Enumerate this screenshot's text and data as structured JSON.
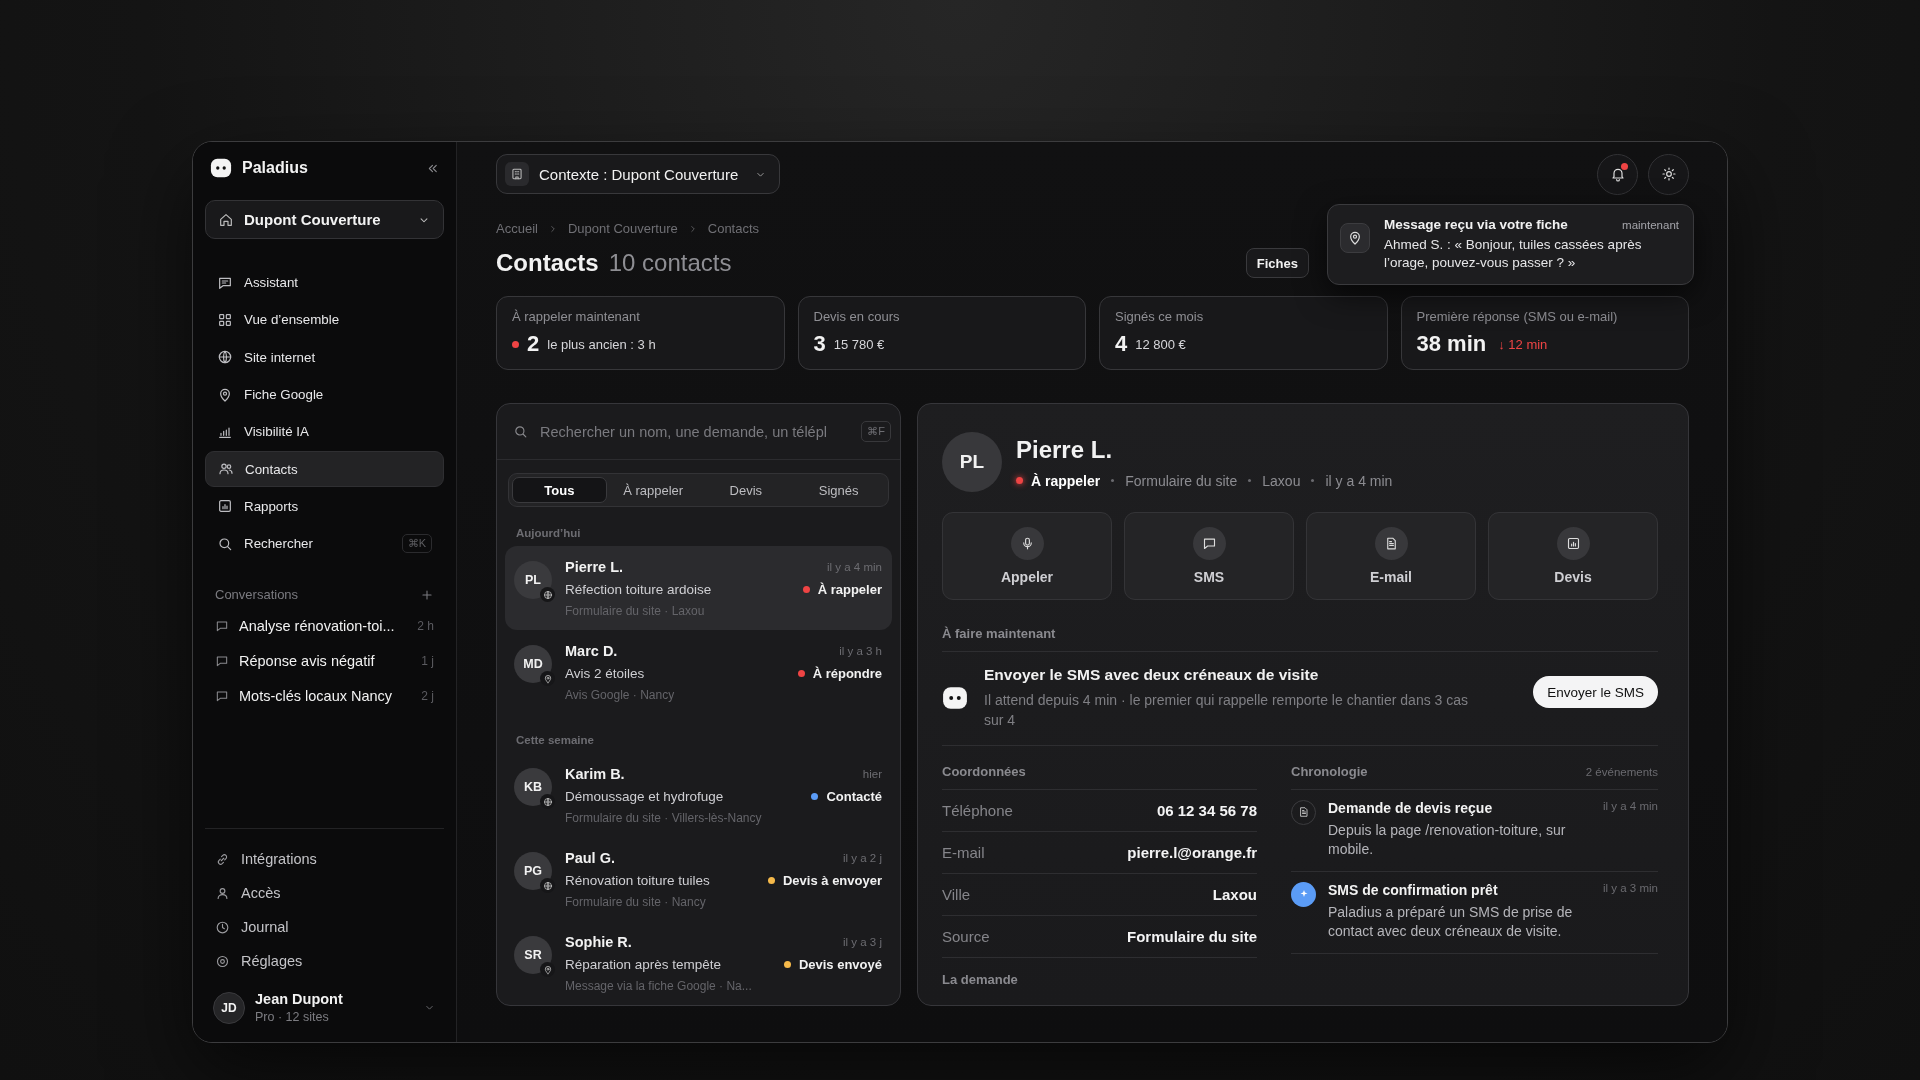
{
  "sidebar": {
    "brand": "Paladius",
    "workspace": "Dupont Couverture",
    "nav": [
      {
        "label": "Assistant",
        "selected": false
      },
      {
        "label": "Vue d’ensemble",
        "selected": false
      },
      {
        "label": "Site internet",
        "selected": false
      },
      {
        "label": "Fiche Google",
        "selected": false
      },
      {
        "label": "Visibilité IA",
        "selected": false
      },
      {
        "label": "Contacts",
        "selected": true
      },
      {
        "label": "Rapports",
        "selected": false
      },
      {
        "label": "Rechercher",
        "selected": false,
        "shortcut": "⌘K"
      }
    ],
    "conversations_title": "Conversations",
    "conversations": [
      {
        "title": "Analyse rénovation-toi...",
        "age": "2 h"
      },
      {
        "title": "Réponse avis négatif",
        "age": "1 j"
      },
      {
        "title": "Mots-clés locaux Nancy",
        "age": "2 j"
      }
    ],
    "footer_nav": [
      "Intégrations",
      "Accès",
      "Journal",
      "Réglages"
    ],
    "user": {
      "initials": "JD",
      "name": "Jean Dupont",
      "plan": "Pro · 12 sites"
    }
  },
  "header": {
    "context": "Contexte : Dupont Couverture",
    "unread": true
  },
  "toast": {
    "title": "Message reçu via votre fiche",
    "time": "maintenant",
    "body": "Ahmed S. : « Bonjour, tuiles cassées après l’orage, pouvez-vous passer ? »"
  },
  "breadcrumb": [
    "Accueil",
    "Dupont Couverture",
    "Contacts"
  ],
  "page": {
    "title": "Contacts",
    "count": "10 contacts",
    "action": "Fiches"
  },
  "stats": [
    {
      "label": "À rappeler maintenant",
      "value": "2",
      "detail": "le plus ancien : 3 h",
      "alert": true
    },
    {
      "label": "Devis en cours",
      "value": "3",
      "detail": "15 780 €",
      "alert": false
    },
    {
      "label": "Signés ce mois",
      "value": "4",
      "detail": "12 800 €",
      "alert": false
    },
    {
      "label": "Première réponse (SMS ou e-mail)",
      "value": "38 min",
      "trend": "↓ 12 min",
      "alert": false
    }
  ],
  "list": {
    "placeholder": "Rechercher un nom, une demande, un télépl",
    "shortcut": "⌘F",
    "filters": [
      {
        "label": "Tous",
        "selected": true
      },
      {
        "label": "À rappeler",
        "selected": false
      },
      {
        "label": "Devis",
        "selected": false
      },
      {
        "label": "Signés",
        "selected": false
      }
    ],
    "groups": [
      {
        "title": "Aujourd’hui",
        "contacts": [
          {
            "initials": "PL",
            "name": "Pierre L.",
            "request": "Réfection toiture ardoise",
            "meta": "Formulaire du site · Laxou",
            "time": "il y a 4 min",
            "status": "À rappeler",
            "color": "#ef4444",
            "google_source": false,
            "selected": true
          },
          {
            "initials": "MD",
            "name": "Marc D.",
            "request": "Avis 2 étoiles",
            "meta": "Avis Google · Nancy",
            "time": "il y a 3 h",
            "status": "À répondre",
            "color": "#ef4444",
            "google_source": true,
            "selected": false
          }
        ]
      },
      {
        "title": "Cette semaine",
        "contacts": [
          {
            "initials": "KB",
            "name": "Karim B.",
            "request": "Démoussage et hydrofuge",
            "meta": "Formulaire du site · Villers-lès-Nancy",
            "time": "hier",
            "status": "Contacté",
            "color": "#5b9cf6",
            "google_source": false,
            "selected": false
          },
          {
            "initials": "PG",
            "name": "Paul G.",
            "request": "Rénovation toiture tuiles",
            "meta": "Formulaire du site · Nancy",
            "time": "il y a 2 j",
            "status": "Devis à envoyer",
            "color": "#f5b94a",
            "google_source": false,
            "selected": false
          },
          {
            "initials": "SR",
            "name": "Sophie R.",
            "request": "Réparation après tempête",
            "meta": "Message via la fiche Google · Na...",
            "time": "il y a 3 j",
            "status": "Devis envoyé",
            "color": "#f5b94a",
            "google_source": true,
            "selected": false
          }
        ]
      }
    ]
  },
  "detail": {
    "initials": "PL",
    "name": "Pierre L.",
    "status": "À rappeler",
    "color": "#ef4444",
    "meta": [
      "Formulaire du site",
      "Laxou",
      "il y a 4 min"
    ],
    "actions": [
      "Appeler",
      "SMS",
      "E-mail",
      "Devis"
    ],
    "todo": {
      "heading": "À faire maintenant",
      "title": "Envoyer le SMS avec deux créneaux de visite",
      "text": "Il attend depuis 4 min · le premier qui rappelle remporte le chantier dans 3 cas sur 4",
      "button": "Envoyer le SMS"
    },
    "coordinates": {
      "heading": "Coordonnées",
      "rows": [
        {
          "label": "Téléphone",
          "value": "06 12 34 56 78"
        },
        {
          "label": "E-mail",
          "value": "pierre.l@orange.fr"
        },
        {
          "label": "Ville",
          "value": "Laxou"
        },
        {
          "label": "Source",
          "value": "Formulaire du site"
        }
      ]
    },
    "timeline": {
      "heading": "Chronologie",
      "count": "2 événements",
      "events": [
        {
          "kind": "document",
          "title": "Demande de devis reçue",
          "time": "il y a 4 min",
          "text": "Depuis la page /renovation-toiture, sur mobile."
        },
        {
          "kind": "assistant",
          "title": "SMS de confirmation prêt",
          "time": "il y a 3 min",
          "text": "Paladius a préparé un SMS de prise de contact avec deux créneaux de visite."
        }
      ]
    },
    "request_heading": "La demande"
  }
}
